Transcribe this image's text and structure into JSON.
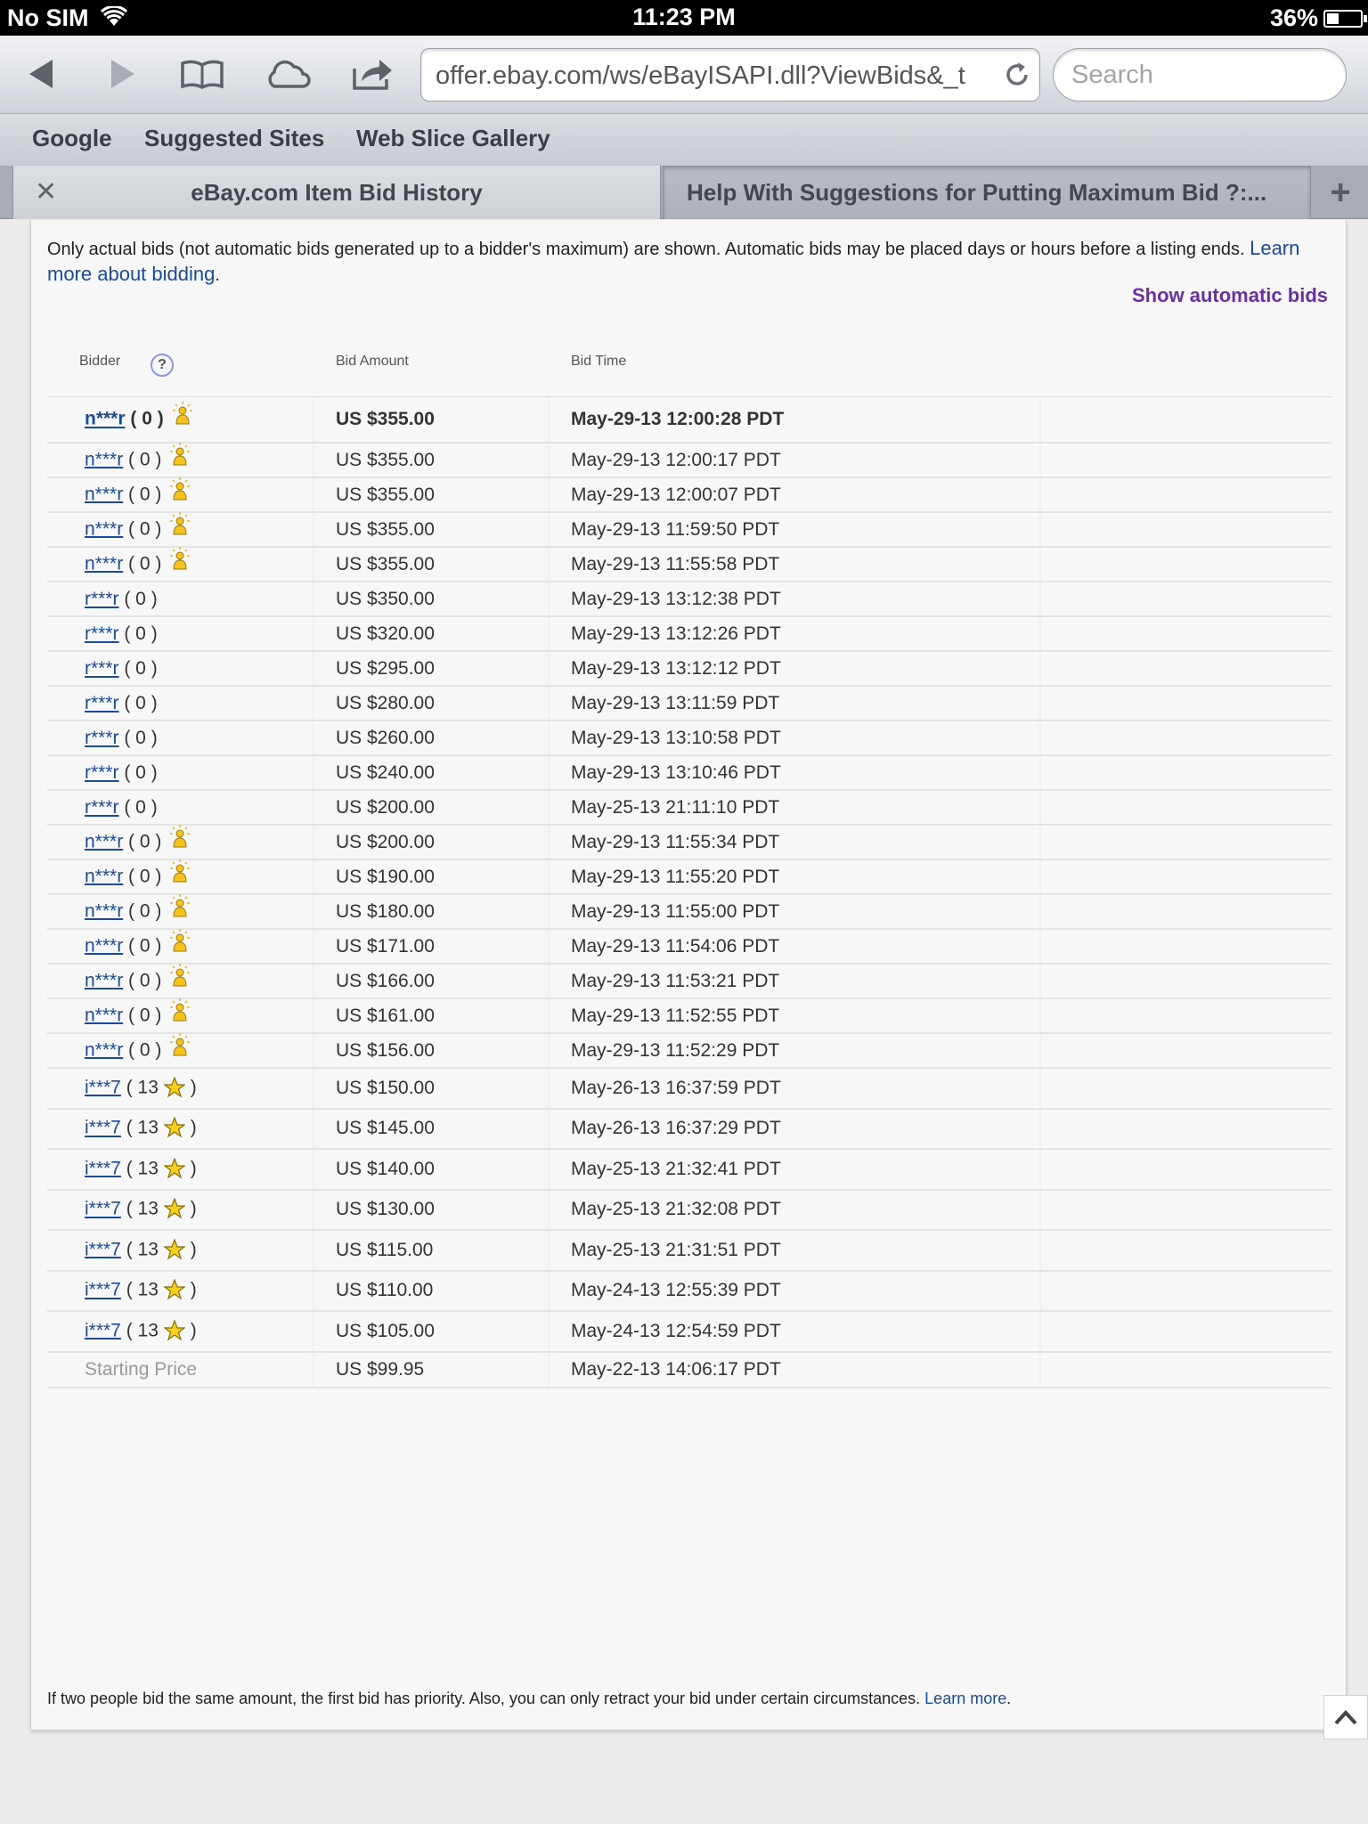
{
  "status_bar": {
    "carrier": "No SIM",
    "time": "11:23 PM",
    "battery_pct": "36%",
    "battery_level": 0.36
  },
  "toolbar": {
    "url": "offer.ebay.com/ws/eBayISAPI.dll?ViewBids&_t",
    "search_placeholder": "Search"
  },
  "bookmarks": [
    "Google",
    "Suggested Sites",
    "Web Slice Gallery"
  ],
  "tabs": [
    {
      "title": "eBay.com Item Bid History",
      "active": true
    },
    {
      "title": "Help With Suggestions for Putting Maximum Bid ?:...",
      "active": false
    }
  ],
  "page": {
    "intro_text": "Only actual bids (not automatic bids generated up to a bidder's maximum) are shown. Automatic bids may be placed days or hours before a listing ends.",
    "intro_link": "Learn more about bidding",
    "show_automatic": "Show automatic bids",
    "columns": {
      "bidder": "Bidder",
      "amount": "Bid Amount",
      "time": "Bid Time"
    },
    "help_glyph": "?",
    "footer_text": "If two people bid the same amount, the first bid has priority. Also, you can only retract your bid under certain circumstances.",
    "footer_link": "Learn more",
    "bids": [
      {
        "bidder": "n***r",
        "feedback": "( 0 )",
        "badge": "new-member-icon",
        "amount": "US $355.00",
        "time": "May-29-13 12:00:28 PDT",
        "bold": true
      },
      {
        "bidder": "n***r",
        "feedback": "( 0 )",
        "badge": "new-member-icon",
        "amount": "US $355.00",
        "time": "May-29-13 12:00:17 PDT"
      },
      {
        "bidder": "n***r",
        "feedback": "( 0 )",
        "badge": "new-member-icon",
        "amount": "US $355.00",
        "time": "May-29-13 12:00:07 PDT"
      },
      {
        "bidder": "n***r",
        "feedback": "( 0 )",
        "badge": "new-member-icon",
        "amount": "US $355.00",
        "time": "May-29-13 11:59:50 PDT"
      },
      {
        "bidder": "n***r",
        "feedback": "( 0 )",
        "badge": "new-member-icon",
        "amount": "US $355.00",
        "time": "May-29-13 11:55:58 PDT"
      },
      {
        "bidder": "r***r",
        "feedback": "( 0 )",
        "badge": "",
        "amount": "US $350.00",
        "time": "May-29-13 13:12:38 PDT"
      },
      {
        "bidder": "r***r",
        "feedback": "( 0 )",
        "badge": "",
        "amount": "US $320.00",
        "time": "May-29-13 13:12:26 PDT"
      },
      {
        "bidder": "r***r",
        "feedback": "( 0 )",
        "badge": "",
        "amount": "US $295.00",
        "time": "May-29-13 13:12:12 PDT"
      },
      {
        "bidder": "r***r",
        "feedback": "( 0 )",
        "badge": "",
        "amount": "US $280.00",
        "time": "May-29-13 13:11:59 PDT"
      },
      {
        "bidder": "r***r",
        "feedback": "( 0 )",
        "badge": "",
        "amount": "US $260.00",
        "time": "May-29-13 13:10:58 PDT"
      },
      {
        "bidder": "r***r",
        "feedback": "( 0 )",
        "badge": "",
        "amount": "US $240.00",
        "time": "May-29-13 13:10:46 PDT"
      },
      {
        "bidder": "r***r",
        "feedback": "( 0 )",
        "badge": "",
        "amount": "US $200.00",
        "time": "May-25-13 21:11:10 PDT"
      },
      {
        "bidder": "n***r",
        "feedback": "( 0 )",
        "badge": "new-member-icon",
        "amount": "US $200.00",
        "time": "May-29-13 11:55:34 PDT"
      },
      {
        "bidder": "n***r",
        "feedback": "( 0 )",
        "badge": "new-member-icon",
        "amount": "US $190.00",
        "time": "May-29-13 11:55:20 PDT"
      },
      {
        "bidder": "n***r",
        "feedback": "( 0 )",
        "badge": "new-member-icon",
        "amount": "US $180.00",
        "time": "May-29-13 11:55:00 PDT"
      },
      {
        "bidder": "n***r",
        "feedback": "( 0 )",
        "badge": "new-member-icon",
        "amount": "US $171.00",
        "time": "May-29-13 11:54:06 PDT"
      },
      {
        "bidder": "n***r",
        "feedback": "( 0 )",
        "badge": "new-member-icon",
        "amount": "US $166.00",
        "time": "May-29-13 11:53:21 PDT"
      },
      {
        "bidder": "n***r",
        "feedback": "( 0 )",
        "badge": "new-member-icon",
        "amount": "US $161.00",
        "time": "May-29-13 11:52:55 PDT"
      },
      {
        "bidder": "n***r",
        "feedback": "( 0 )",
        "badge": "new-member-icon",
        "amount": "US $156.00",
        "time": "May-29-13 11:52:29 PDT"
      },
      {
        "bidder": "i***7",
        "feedback": "( 13",
        "badge": "star-icon",
        "feedback_close": ")",
        "amount": "US $150.00",
        "time": "May-26-13 16:37:59 PDT"
      },
      {
        "bidder": "i***7",
        "feedback": "( 13",
        "badge": "star-icon",
        "feedback_close": ")",
        "amount": "US $145.00",
        "time": "May-26-13 16:37:29 PDT"
      },
      {
        "bidder": "i***7",
        "feedback": "( 13",
        "badge": "star-icon",
        "feedback_close": ")",
        "amount": "US $140.00",
        "time": "May-25-13 21:32:41 PDT"
      },
      {
        "bidder": "i***7",
        "feedback": "( 13",
        "badge": "star-icon",
        "feedback_close": ")",
        "amount": "US $130.00",
        "time": "May-25-13 21:32:08 PDT"
      },
      {
        "bidder": "i***7",
        "feedback": "( 13",
        "badge": "star-icon",
        "feedback_close": ")",
        "amount": "US $115.00",
        "time": "May-25-13 21:31:51 PDT"
      },
      {
        "bidder": "i***7",
        "feedback": "( 13",
        "badge": "star-icon",
        "feedback_close": ")",
        "amount": "US $110.00",
        "time": "May-24-13 12:55:39 PDT"
      },
      {
        "bidder": "i***7",
        "feedback": "( 13",
        "badge": "star-icon",
        "feedback_close": ")",
        "amount": "US $105.00",
        "time": "May-24-13 12:54:59 PDT"
      },
      {
        "bidder": "Starting Price",
        "feedback": "",
        "badge": "",
        "amount": "US $99.95",
        "time": "May-22-13 14:06:17 PDT",
        "start": true
      }
    ]
  }
}
